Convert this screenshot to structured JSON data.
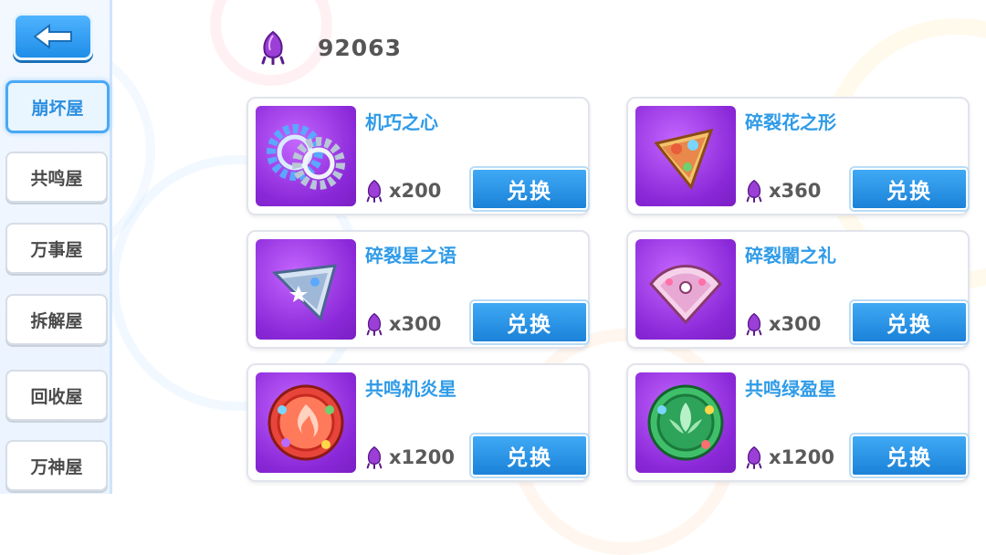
{
  "currency": {
    "amount": "92063",
    "icon": "purple-gem-icon"
  },
  "sidebar": {
    "back_icon": "back-arrow-icon",
    "items": [
      {
        "label": "崩坏屋",
        "active": true
      },
      {
        "label": "共鸣屋",
        "active": false
      },
      {
        "label": "万事屋",
        "active": false
      },
      {
        "label": "拆解屋",
        "active": false
      },
      {
        "label": "回收屋",
        "active": false
      },
      {
        "label": "万神屋",
        "active": false
      }
    ]
  },
  "shop": {
    "button_label": "兑换",
    "items": [
      {
        "name": "机巧之心",
        "cost": "x200",
        "icon": "twin-gears-icon"
      },
      {
        "name": "碎裂花之形",
        "cost": "x360",
        "icon": "flower-fragment-icon"
      },
      {
        "name": "碎裂星之语",
        "cost": "x300",
        "icon": "star-fragment-icon"
      },
      {
        "name": "碎裂闇之礼",
        "cost": "x300",
        "icon": "dark-fragment-icon"
      },
      {
        "name": "共鸣机炎星",
        "cost": "x1200",
        "icon": "fire-star-icon"
      },
      {
        "name": "共鸣绿盈星",
        "cost": "x1200",
        "icon": "green-star-icon"
      }
    ]
  },
  "colors": {
    "accent": "#2f9be8",
    "button": "#1b82d8",
    "item_bg": "#8a28d8"
  }
}
